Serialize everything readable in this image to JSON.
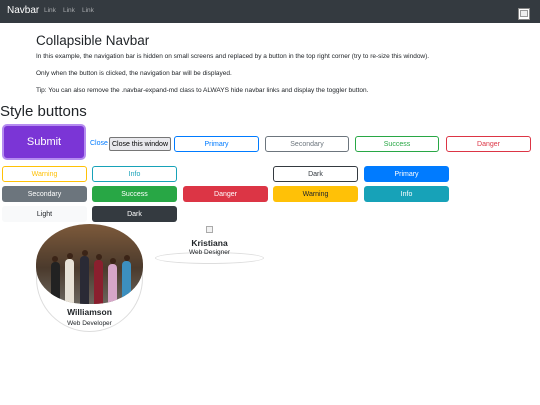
{
  "navbar": {
    "brand": "Navbar",
    "links": [
      "Link",
      "Link",
      "Link"
    ]
  },
  "intro": {
    "title": "Collapsible Navbar",
    "p1": "In this example, the navigation bar is hidden on small screens and replaced by a button in the top right corner (try to re-size this window).",
    "p2": "Only when the button is clicked, the navigation bar will be displayed.",
    "p3": "Tip: You can also remove the .navbar-expand-md class to ALWAYS hide navbar links and display the toggler button."
  },
  "section_title": "Style buttons",
  "row1": {
    "submit": "Submit",
    "close_link": "Close",
    "close_window": "Close this window",
    "outline": [
      "Primary",
      "Secondary",
      "Success",
      "Danger"
    ]
  },
  "row2": [
    "Warning",
    "Info",
    "Dark",
    "Primary"
  ],
  "row3": [
    "Secondary",
    "Success",
    "Danger",
    "Warning",
    "Info"
  ],
  "row4": [
    "Light",
    "Dark"
  ],
  "cards": [
    {
      "name": "Williamson",
      "role": "Web Developer"
    },
    {
      "name": "Kristiana",
      "role": "Web Designer"
    }
  ],
  "colors": {
    "navbar": "#343a40",
    "submit": "#7b35d6",
    "primary": "#007bff",
    "secondary": "#6c757d",
    "success": "#28a745",
    "danger": "#dc3545",
    "warning": "#ffc107",
    "info": "#17a2b8",
    "dark": "#343a40",
    "light": "#f8f9fa"
  }
}
